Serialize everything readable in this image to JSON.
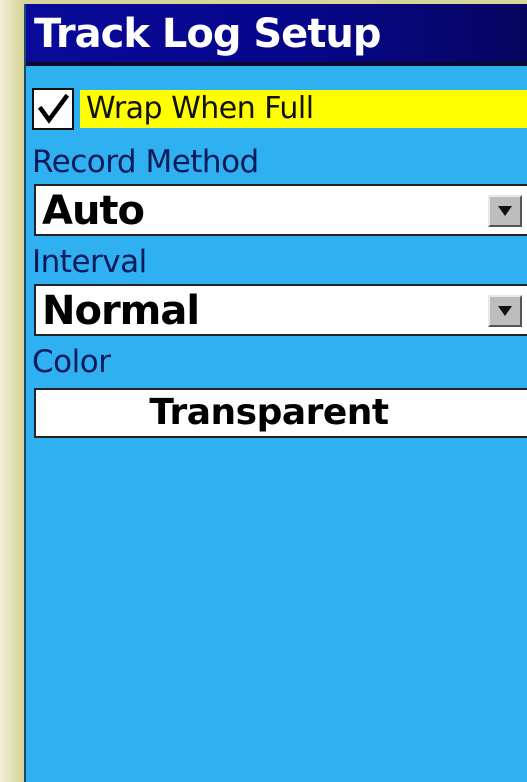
{
  "screen": {
    "title": "Track Log Setup"
  },
  "wrap_when_full": {
    "label": "Wrap When Full",
    "checked": true
  },
  "record_method": {
    "label": "Record Method",
    "value": "Auto"
  },
  "interval": {
    "label": "Interval",
    "value": "Normal"
  },
  "color": {
    "label": "Color",
    "value": "Transparent"
  },
  "colors": {
    "title_bar": "#0a0a9a",
    "screen_background": "#2fb0f0",
    "highlight": "#ffff00",
    "label_text": "#0b1a5a"
  },
  "icons": {
    "checkbox": "checkmark-icon",
    "dropdown": "dropdown-arrow-icon"
  }
}
